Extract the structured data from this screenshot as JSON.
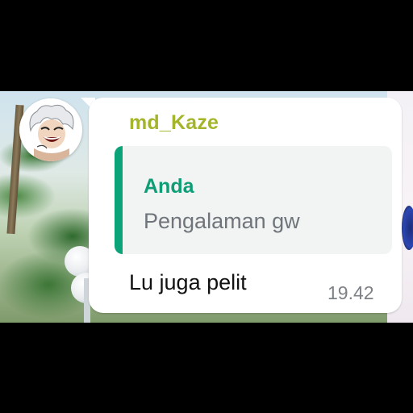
{
  "message": {
    "sender_name": "md_Kaze",
    "quoted_author": "Anda",
    "quoted_text": "Pengalaman gw",
    "text": "Lu juga pelit",
    "time": "19.42"
  },
  "colors": {
    "sender_name": "#a4b52c",
    "quote_bar": "#0aa478",
    "quote_author": "#0f9d76",
    "quote_bg": "#f2f3f3",
    "bubble_bg": "#ffffff"
  },
  "icons": {
    "avatar": "anime-character-avatar-icon"
  }
}
